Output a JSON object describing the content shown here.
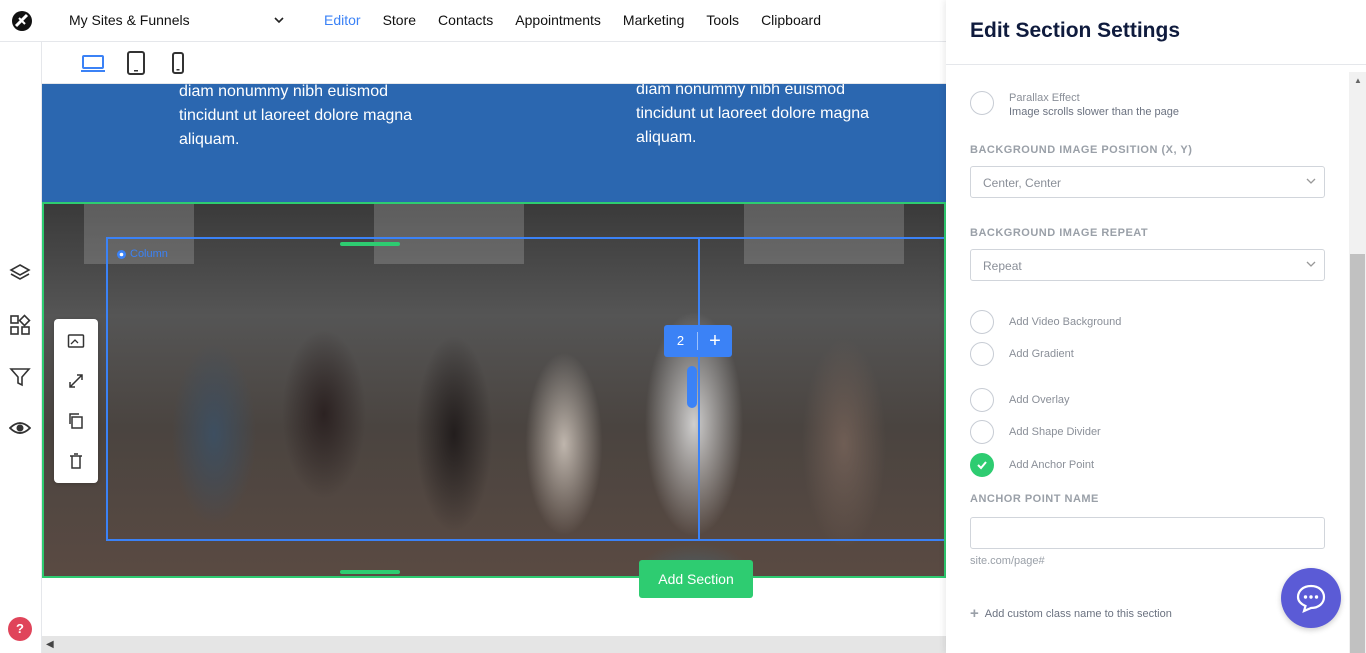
{
  "topbar": {
    "site_selector": "My Sites & Funnels",
    "nav": [
      "Editor",
      "Store",
      "Contacts",
      "Appointments",
      "Marketing",
      "Tools",
      "Clipboard"
    ],
    "active_nav": "Editor"
  },
  "canvas": {
    "feature_left_text": "diam nonummy nibh euismod tincidunt ut laoreet dolore magna aliquam.",
    "feature_right_text": "diam nonummy nibh euismod tincidunt ut laoreet dolore magna aliquam.",
    "column_label": "Column",
    "column_count": "2",
    "column_add": "+",
    "add_section_label": "Add Section"
  },
  "panel": {
    "title": "Edit Section Settings",
    "parallax_label": "Parallax Effect",
    "parallax_sub": "Image scrolls slower than the page",
    "bg_position_label": "BACKGROUND IMAGE POSITION (X, Y)",
    "bg_position_value": "Center, Center",
    "bg_repeat_label": "BACKGROUND IMAGE REPEAT",
    "bg_repeat_value": "Repeat",
    "options": [
      {
        "label": "Add Video Background",
        "checked": false
      },
      {
        "label": "Add Gradient",
        "checked": false
      },
      {
        "label": "Add Overlay",
        "checked": false
      },
      {
        "label": "Add Shape Divider",
        "checked": false
      },
      {
        "label": "Add Anchor Point",
        "checked": true
      }
    ],
    "anchor_label": "ANCHOR POINT NAME",
    "anchor_value": "",
    "anchor_hint": "site.com/page#",
    "custom_class_label": "Add custom class name to this section"
  },
  "help_label": "?",
  "colors": {
    "accent": "#3b82f6",
    "green": "#2ecc71",
    "section_blue": "#2b67b0",
    "chat": "#5b5bd6"
  }
}
